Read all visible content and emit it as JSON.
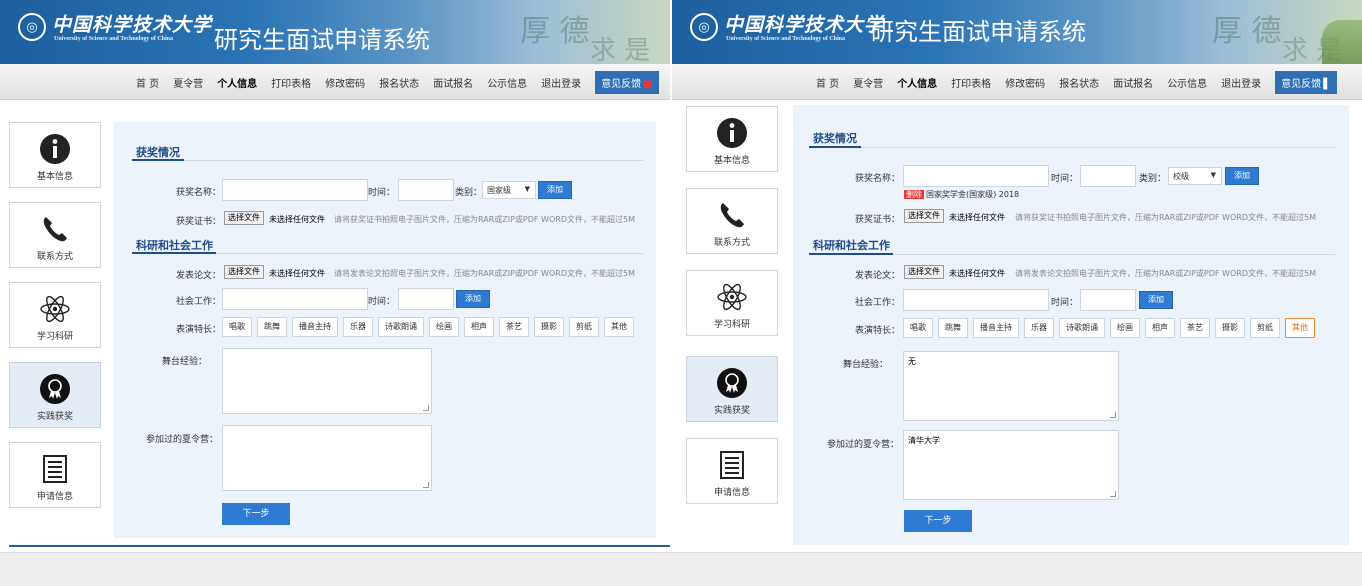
{
  "header": {
    "school_cn": "中国科学技术大学",
    "school_en": "University of Science and Technology of China",
    "system_title": "研究生面试申请系统",
    "logo_icon": "seal-logo-icon"
  },
  "nav": {
    "items": [
      "首 页",
      "夏令营",
      "个人信息",
      "打印表格",
      "修改密码",
      "报名状态",
      "面试报名",
      "公示信息",
      "退出登录"
    ],
    "current": "个人信息",
    "feedback": "意见反馈"
  },
  "sidebar": {
    "items": [
      {
        "label": "基本信息",
        "icon": "info-icon"
      },
      {
        "label": "联系方式",
        "icon": "phone-icon"
      },
      {
        "label": "学习科研",
        "icon": "atom-icon"
      },
      {
        "label": "实践获奖",
        "icon": "medal-icon"
      },
      {
        "label": "申请信息",
        "icon": "document-list-icon"
      }
    ],
    "active": "实践获奖"
  },
  "form": {
    "awards_section": "获奖情况",
    "award_name_label": "获奖名称：",
    "time_label": "时间：",
    "category_label": "类别：",
    "add_button": "添加",
    "certificate_label": "获奖证书：",
    "choose_file_button": "选择文件",
    "no_file_text": "未选择任何文件",
    "certificate_hint": "请将获奖证书拍照电子图片文件，压缩为RAR或ZIP或PDF WORD文件，不能超过5M",
    "research_section": "科研和社会工作",
    "paper_label": "发表论文：",
    "paper_hint": "请将发表论文拍照电子图片文件，压缩为RAR或ZIP或PDF WORD文件，不能超过5M",
    "social_work_label": "社会工作：",
    "talent_label": "表演特长：",
    "talents": [
      "唱歌",
      "跳舞",
      "播音主持",
      "乐器",
      "诗歌朗诵",
      "绘画",
      "相声",
      "茶艺",
      "摄影",
      "剪纸",
      "其他"
    ],
    "stage_experience_label": "舞台经验：",
    "summer_camp_label": "参加过的夏令营：",
    "next_button": "下一步"
  },
  "left_state": {
    "category_value": "国家级",
    "stage_experience_value": "",
    "summer_camp_value": ""
  },
  "right_state": {
    "category_value": "校级",
    "award_delete_label": "删除",
    "award_entry": "国家奖学金(国家级) 2018",
    "selected_talent": "其他",
    "stage_experience_value": "无",
    "summer_camp_value": "清华大学"
  },
  "colors": {
    "primary": "#2f7ad2",
    "section_title": "#1f4c8a",
    "content_bg": "#edf3fa",
    "selected_tag": "#f08c3c"
  }
}
